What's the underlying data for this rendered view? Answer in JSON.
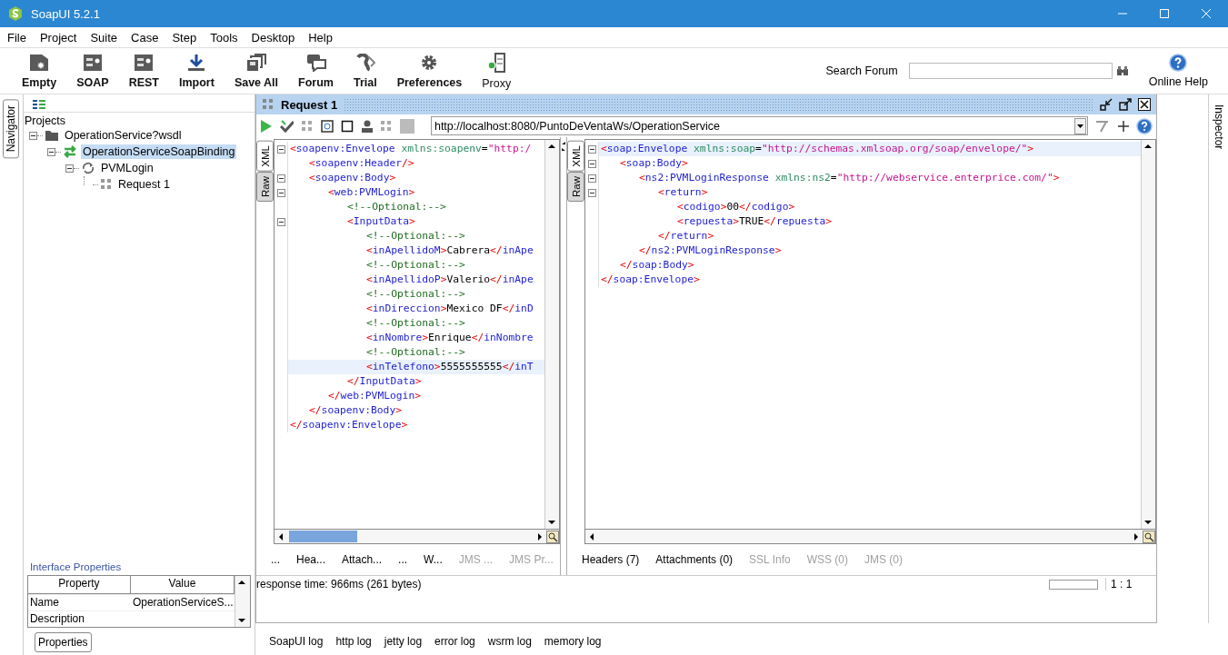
{
  "window": {
    "title": "SoapUI 5.2.1"
  },
  "menu": [
    "File",
    "Project",
    "Suite",
    "Case",
    "Step",
    "Tools",
    "Desktop",
    "Help"
  ],
  "toolbar": [
    {
      "label": "Empty",
      "kind": "empty"
    },
    {
      "label": "SOAP",
      "kind": "soap"
    },
    {
      "label": "REST",
      "kind": "rest"
    },
    {
      "label": "Import",
      "kind": "import"
    },
    {
      "label": "Save All",
      "kind": "save"
    },
    {
      "label": "Forum",
      "kind": "forum"
    },
    {
      "label": "Trial",
      "kind": "trial"
    },
    {
      "label": "Preferences",
      "kind": "preferences"
    },
    {
      "label": "Proxy",
      "kind": "proxy"
    }
  ],
  "search": {
    "label": "Search Forum"
  },
  "help": {
    "label": "Online Help"
  },
  "navigator": {
    "tab": "Navigator",
    "root": "Projects",
    "tree": [
      {
        "label": "OperationService?wsdl",
        "kind": "project",
        "selected": false,
        "expanded": true,
        "children": [
          {
            "label": "OperationServiceSoapBinding",
            "kind": "interface",
            "selected": true,
            "expanded": true,
            "children": [
              {
                "label": "PVMLogin",
                "kind": "operation",
                "selected": false,
                "expanded": true,
                "children": [
                  {
                    "label": "Request 1",
                    "kind": "request",
                    "selected": false
                  }
                ]
              }
            ]
          }
        ]
      }
    ]
  },
  "properties": {
    "title": "Interface Properties",
    "columns": [
      "Property",
      "Value"
    ],
    "rows": [
      [
        "Name",
        "OperationServiceS..."
      ],
      [
        "Description"
      ]
    ],
    "button": "Properties"
  },
  "request": {
    "title": "Request 1",
    "url": "http://localhost:8080/PuntoDeVentaWs/OperationService",
    "request_editor": {
      "tabs": [
        {
          "label": "XML",
          "selected": true
        },
        {
          "label": "Raw",
          "selected": false
        }
      ],
      "lines": [
        {
          "current": false,
          "tokens": [
            {
              "kind": "punct",
              "text": "<"
            },
            {
              "kind": "tag",
              "text": "soapenv:Envelope"
            },
            {
              "kind": "attr",
              "text": " xmlns:soapenv"
            },
            {
              "kind": "text",
              "text": "="
            },
            {
              "kind": "value",
              "text": "\"http:/"
            }
          ],
          "children": [
            {
              "current": false,
              "tokens": [
                {
                  "kind": "punct",
                  "text": "<"
                },
                {
                  "kind": "tag",
                  "text": "soapenv:Header"
                },
                {
                  "kind": "punct",
                  "text": "/>"
                }
              ]
            },
            {
              "current": false,
              "tokens": [
                {
                  "kind": "punct",
                  "text": "<"
                },
                {
                  "kind": "tag",
                  "text": "soapenv:Body"
                },
                {
                  "kind": "punct",
                  "text": ">"
                }
              ],
              "children": [
                {
                  "current": false,
                  "tokens": [
                    {
                      "kind": "punct",
                      "text": "<"
                    },
                    {
                      "kind": "tag",
                      "text": "web:PVMLogin"
                    },
                    {
                      "kind": "punct",
                      "text": ">"
                    }
                  ],
                  "children": [
                    {
                      "current": false,
                      "tokens": [
                        {
                          "kind": "comment",
                          "text": "<!--Optional:-->"
                        }
                      ]
                    },
                    {
                      "current": false,
                      "tokens": [
                        {
                          "kind": "punct",
                          "text": "<"
                        },
                        {
                          "kind": "tag",
                          "text": "InputData"
                        },
                        {
                          "kind": "punct",
                          "text": ">"
                        }
                      ],
                      "children": [
                        {
                          "current": false,
                          "tokens": [
                            {
                              "kind": "comment",
                              "text": "<!--Optional:-->"
                            }
                          ]
                        },
                        {
                          "current": false,
                          "tokens": [
                            {
                              "kind": "punct",
                              "text": "<"
                            },
                            {
                              "kind": "tag",
                              "text": "inApellidoM"
                            },
                            {
                              "kind": "punct",
                              "text": ">"
                            },
                            {
                              "kind": "text",
                              "text": "Cabrera"
                            },
                            {
                              "kind": "punct",
                              "text": "</"
                            },
                            {
                              "kind": "tag",
                              "text": "inApe"
                            }
                          ]
                        },
                        {
                          "current": false,
                          "tokens": [
                            {
                              "kind": "comment",
                              "text": "<!--Optional:-->"
                            }
                          ]
                        },
                        {
                          "current": false,
                          "tokens": [
                            {
                              "kind": "punct",
                              "text": "<"
                            },
                            {
                              "kind": "tag",
                              "text": "inApellidoP"
                            },
                            {
                              "kind": "punct",
                              "text": ">"
                            },
                            {
                              "kind": "text",
                              "text": "Valerio"
                            },
                            {
                              "kind": "punct",
                              "text": "</"
                            },
                            {
                              "kind": "tag",
                              "text": "inApe"
                            }
                          ]
                        },
                        {
                          "current": false,
                          "tokens": [
                            {
                              "kind": "comment",
                              "text": "<!--Optional:-->"
                            }
                          ]
                        },
                        {
                          "current": false,
                          "tokens": [
                            {
                              "kind": "punct",
                              "text": "<"
                            },
                            {
                              "kind": "tag",
                              "text": "inDireccion"
                            },
                            {
                              "kind": "punct",
                              "text": ">"
                            },
                            {
                              "kind": "text",
                              "text": "Mexico DF"
                            },
                            {
                              "kind": "punct",
                              "text": "</"
                            },
                            {
                              "kind": "tag",
                              "text": "inD"
                            }
                          ]
                        },
                        {
                          "current": false,
                          "tokens": [
                            {
                              "kind": "comment",
                              "text": "<!--Optional:-->"
                            }
                          ]
                        },
                        {
                          "current": false,
                          "tokens": [
                            {
                              "kind": "punct",
                              "text": "<"
                            },
                            {
                              "kind": "tag",
                              "text": "inNombre"
                            },
                            {
                              "kind": "punct",
                              "text": ">"
                            },
                            {
                              "kind": "text",
                              "text": "Enrique"
                            },
                            {
                              "kind": "punct",
                              "text": "</"
                            },
                            {
                              "kind": "tag",
                              "text": "inNombre"
                            }
                          ]
                        },
                        {
                          "current": false,
                          "tokens": [
                            {
                              "kind": "comment",
                              "text": "<!--Optional:-->"
                            }
                          ]
                        },
                        {
                          "current": true,
                          "tokens": [
                            {
                              "kind": "punct",
                              "text": "<"
                            },
                            {
                              "kind": "tag",
                              "text": "inTelefono"
                            },
                            {
                              "kind": "punct",
                              "text": ">"
                            },
                            {
                              "kind": "text",
                              "text": "5555555555"
                            },
                            {
                              "kind": "punct",
                              "text": "</"
                            },
                            {
                              "kind": "tag",
                              "text": "inT"
                            }
                          ]
                        }
                      ]
                    },
                    {
                      "current": false,
                      "tokens": [
                        {
                          "kind": "punct",
                          "text": "</"
                        },
                        {
                          "kind": "tag",
                          "text": "InputData"
                        },
                        {
                          "kind": "punct",
                          "text": ">"
                        }
                      ]
                    }
                  ]
                },
                {
                  "current": false,
                  "tokens": [
                    {
                      "kind": "punct",
                      "text": "</"
                    },
                    {
                      "kind": "tag",
                      "text": "web:PVMLogin"
                    },
                    {
                      "kind": "punct",
                      "text": ">"
                    }
                  ]
                }
              ]
            },
            {
              "current": false,
              "tokens": [
                {
                  "kind": "punct",
                  "text": "</"
                },
                {
                  "kind": "tag",
                  "text": "soapenv:Body"
                },
                {
                  "kind": "punct",
                  "text": ">"
                }
              ]
            }
          ]
        },
        {
          "current": false,
          "tokens": [
            {
              "kind": "punct",
              "text": "</"
            },
            {
              "kind": "tag",
              "text": "soapenv:Envelope"
            },
            {
              "kind": "punct",
              "text": ">"
            }
          ]
        }
      ],
      "bottom_tabs": [
        {
          "label": "...",
          "disabled": false
        },
        {
          "label": "Hea...",
          "disabled": false
        },
        {
          "label": "Attach...",
          "disabled": false
        },
        {
          "label": "...",
          "disabled": false
        },
        {
          "label": "W...",
          "disabled": false
        },
        {
          "label": "JMS ...",
          "disabled": true
        },
        {
          "label": "JMS Pr...",
          "disabled": true
        }
      ]
    },
    "response_editor": {
      "tabs": [
        {
          "label": "XML",
          "selected": true
        },
        {
          "label": "Raw",
          "selected": false
        }
      ],
      "lines": [
        {
          "current": true,
          "tokens": [
            {
              "kind": "punct",
              "text": "<"
            },
            {
              "kind": "tag",
              "text": "soap:Envelope"
            },
            {
              "kind": "attr",
              "text": " xmlns:soap"
            },
            {
              "kind": "text",
              "text": "="
            },
            {
              "kind": "value",
              "text": "\"http://schemas.xmlsoap.org/soap/envelope/\""
            },
            {
              "kind": "punct",
              "text": ">"
            }
          ],
          "children": [
            {
              "current": false,
              "tokens": [
                {
                  "kind": "punct",
                  "text": "<"
                },
                {
                  "kind": "tag",
                  "text": "soap:Body"
                },
                {
                  "kind": "punct",
                  "text": ">"
                }
              ],
              "children": [
                {
                  "current": false,
                  "tokens": [
                    {
                      "kind": "punct",
                      "text": "<"
                    },
                    {
                      "kind": "tag",
                      "text": "ns2:PVMLoginResponse"
                    },
                    {
                      "kind": "attr",
                      "text": " xmlns:ns2"
                    },
                    {
                      "kind": "text",
                      "text": "="
                    },
                    {
                      "kind": "value",
                      "text": "\"http://webservice.enterprice.com/\""
                    },
                    {
                      "kind": "punct",
                      "text": ">"
                    }
                  ],
                  "children": [
                    {
                      "current": false,
                      "tokens": [
                        {
                          "kind": "punct",
                          "text": "<"
                        },
                        {
                          "kind": "tag",
                          "text": "return"
                        },
                        {
                          "kind": "punct",
                          "text": ">"
                        }
                      ],
                      "children": [
                        {
                          "current": false,
                          "tokens": [
                            {
                              "kind": "punct",
                              "text": "<"
                            },
                            {
                              "kind": "tag",
                              "text": "codigo"
                            },
                            {
                              "kind": "punct",
                              "text": ">"
                            },
                            {
                              "kind": "text",
                              "text": "00"
                            },
                            {
                              "kind": "punct",
                              "text": "</"
                            },
                            {
                              "kind": "tag",
                              "text": "codigo"
                            },
                            {
                              "kind": "punct",
                              "text": ">"
                            }
                          ]
                        },
                        {
                          "current": false,
                          "tokens": [
                            {
                              "kind": "punct",
                              "text": "<"
                            },
                            {
                              "kind": "tag",
                              "text": "repuesta"
                            },
                            {
                              "kind": "punct",
                              "text": ">"
                            },
                            {
                              "kind": "text",
                              "text": "TRUE"
                            },
                            {
                              "kind": "punct",
                              "text": "</"
                            },
                            {
                              "kind": "tag",
                              "text": "repuesta"
                            },
                            {
                              "kind": "punct",
                              "text": ">"
                            }
                          ]
                        }
                      ]
                    },
                    {
                      "current": false,
                      "tokens": [
                        {
                          "kind": "punct",
                          "text": "</"
                        },
                        {
                          "kind": "tag",
                          "text": "return"
                        },
                        {
                          "kind": "punct",
                          "text": ">"
                        }
                      ]
                    }
                  ]
                },
                {
                  "current": false,
                  "tokens": [
                    {
                      "kind": "punct",
                      "text": "</"
                    },
                    {
                      "kind": "tag",
                      "text": "ns2:PVMLoginResponse"
                    },
                    {
                      "kind": "punct",
                      "text": ">"
                    }
                  ]
                }
              ]
            },
            {
              "current": false,
              "tokens": [
                {
                  "kind": "punct",
                  "text": "</"
                },
                {
                  "kind": "tag",
                  "text": "soap:Body"
                },
                {
                  "kind": "punct",
                  "text": ">"
                }
              ]
            }
          ]
        },
        {
          "current": false,
          "tokens": [
            {
              "kind": "punct",
              "text": "</"
            },
            {
              "kind": "tag",
              "text": "soap:Envelope"
            },
            {
              "kind": "punct",
              "text": ">"
            }
          ]
        }
      ],
      "bottom_tabs": [
        {
          "label": "Headers (7)",
          "disabled": false
        },
        {
          "label": "Attachments (0)",
          "disabled": false
        },
        {
          "label": "SSL Info",
          "disabled": true
        },
        {
          "label": "WSS (0)",
          "disabled": true
        },
        {
          "label": "JMS (0)",
          "disabled": true
        }
      ]
    },
    "status": "response time: 966ms (261 bytes)",
    "progress": {
      "level": 0
    },
    "position": "1 : 1"
  },
  "inspector": {
    "tab": "Inspector"
  },
  "log_tabs": [
    "SoapUI log",
    "http log",
    "jetty log",
    "error log",
    "wsrm log",
    "memory log"
  ]
}
